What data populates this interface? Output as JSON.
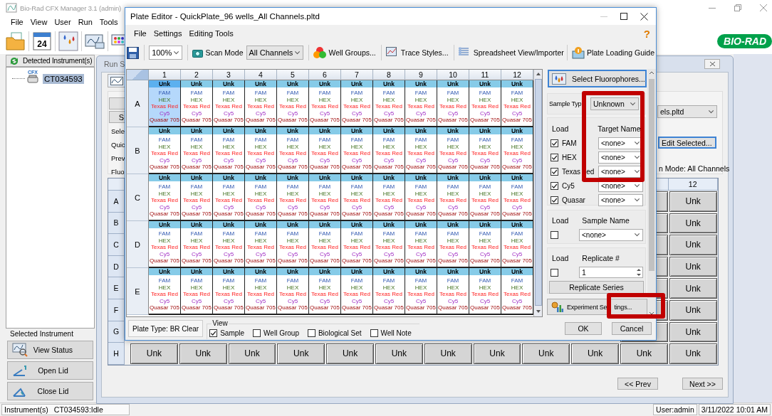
{
  "main_window": {
    "title": "Bio-Rad CFX Manager 3.1 (admin)",
    "menu": [
      "File",
      "View",
      "User",
      "Run",
      "Tools"
    ],
    "calendar_day": "24",
    "logo": "BIO-RAD"
  },
  "instrument_panel": {
    "header_button": "Detected Instrument(s)",
    "tree": [
      {
        "icon_label": "CFX",
        "label": "CT034593",
        "selected": true
      }
    ],
    "group_title": "Selected Instrument",
    "buttons": [
      "View Status",
      "Open Lid",
      "Close Lid"
    ]
  },
  "run_setup": {
    "title": "Run S",
    "side_button": "S",
    "labels": [
      "Sele",
      "Quic",
      "Prev",
      "Fluo"
    ],
    "file_dropdown": "els.pltd",
    "edit_button": "Edit Selected...",
    "scan_mode": "n Mode: All Channels",
    "column_header": "12",
    "row_labels": [
      "A",
      "B",
      "C",
      "D",
      "E",
      "F",
      "G",
      "H"
    ],
    "column_12_cells": [
      "Unk",
      "Unk",
      "Unk",
      "Unk",
      "Unk",
      "Unk",
      "Unk"
    ],
    "row_h_cells": [
      "Unk",
      "Unk",
      "Unk",
      "Unk",
      "Unk",
      "Unk",
      "Unk",
      "Unk",
      "Unk",
      "Unk",
      "Unk",
      "Unk"
    ],
    "buttons": [
      "<< Prev",
      "Next >>"
    ]
  },
  "plate_editor": {
    "title": "Plate Editor - QuickPlate_96 wells_All Channels.pltd",
    "menu": [
      "File",
      "Settings",
      "Editing Tools"
    ],
    "help": "?",
    "toolbar": {
      "zoom": "100%",
      "scan_mode_label": "Scan Mode",
      "scan_mode": "All Channels",
      "tools": [
        "Well Groups...",
        "Trace Styles...",
        "Spreadsheet View/Importer",
        "Plate Loading Guide"
      ]
    },
    "plate": {
      "columns": [
        "1",
        "2",
        "3",
        "4",
        "5",
        "6",
        "7",
        "8",
        "9",
        "10",
        "11",
        "12"
      ],
      "rows": [
        {
          "label": "A",
          "wells": [
            {
              "type": "Unk",
              "selected": true,
              "fluors": [
                "FAM",
                "HEX",
                "Texas Red",
                "Cy5",
                "Quasar 705"
              ]
            },
            {
              "type": "Unk",
              "selected": false,
              "fluors": [
                "FAM",
                "HEX",
                "Texas Red",
                "Cy5",
                "Quasar 705"
              ]
            },
            {
              "type": "Unk",
              "selected": false,
              "fluors": [
                "FAM",
                "HEX",
                "Texas Red",
                "Cy5",
                "Quasar 705"
              ]
            },
            {
              "type": "Unk",
              "selected": false,
              "fluors": [
                "FAM",
                "HEX",
                "Texas Red",
                "Cy5",
                "Quasar 705"
              ]
            },
            {
              "type": "Unk",
              "selected": false,
              "fluors": [
                "FAM",
                "HEX",
                "Texas Red",
                "Cy5",
                "Quasar 705"
              ]
            },
            {
              "type": "Unk",
              "selected": false,
              "fluors": [
                "FAM",
                "HEX",
                "Texas Red",
                "Cy5",
                "Quasar 705"
              ]
            },
            {
              "type": "Unk",
              "selected": false,
              "fluors": [
                "FAM",
                "HEX",
                "Texas Red",
                "Cy5",
                "Quasar 705"
              ]
            },
            {
              "type": "Unk",
              "selected": false,
              "fluors": [
                "FAM",
                "HEX",
                "Texas Red",
                "Cy5",
                "Quasar 705"
              ]
            },
            {
              "type": "Unk",
              "selected": false,
              "fluors": [
                "FAM",
                "HEX",
                "Texas Red",
                "Cy5",
                "Quasar 705"
              ]
            },
            {
              "type": "Unk",
              "selected": false,
              "fluors": [
                "FAM",
                "HEX",
                "Texas Red",
                "Cy5",
                "Quasar 705"
              ]
            },
            {
              "type": "Unk",
              "selected": false,
              "fluors": [
                "FAM",
                "HEX",
                "Texas Red",
                "Cy5",
                "Quasar 705"
              ]
            },
            {
              "type": "Unk",
              "selected": false,
              "fluors": [
                "FAM",
                "HEX",
                "Texas Red",
                "Cy5",
                "Quasar 705"
              ]
            }
          ]
        },
        {
          "label": "B",
          "wells": [
            {
              "type": "Unk",
              "selected": false,
              "fluors": [
                "FAM",
                "HEX",
                "Texas Red",
                "Cy5",
                "Quasar 705"
              ]
            },
            {
              "type": "Unk",
              "selected": false,
              "fluors": [
                "FAM",
                "HEX",
                "Texas Red",
                "Cy5",
                "Quasar 705"
              ]
            },
            {
              "type": "Unk",
              "selected": false,
              "fluors": [
                "FAM",
                "HEX",
                "Texas Red",
                "Cy5",
                "Quasar 705"
              ]
            },
            {
              "type": "Unk",
              "selected": false,
              "fluors": [
                "FAM",
                "HEX",
                "Texas Red",
                "Cy5",
                "Quasar 705"
              ]
            },
            {
              "type": "Unk",
              "selected": false,
              "fluors": [
                "FAM",
                "HEX",
                "Texas Red",
                "Cy5",
                "Quasar 705"
              ]
            },
            {
              "type": "Unk",
              "selected": false,
              "fluors": [
                "FAM",
                "HEX",
                "Texas Red",
                "Cy5",
                "Quasar 705"
              ]
            },
            {
              "type": "Unk",
              "selected": false,
              "fluors": [
                "FAM",
                "HEX",
                "Texas Red",
                "Cy5",
                "Quasar 705"
              ]
            },
            {
              "type": "Unk",
              "selected": false,
              "fluors": [
                "FAM",
                "HEX",
                "Texas Red",
                "Cy5",
                "Quasar 705"
              ]
            },
            {
              "type": "Unk",
              "selected": false,
              "fluors": [
                "FAM",
                "HEX",
                "Texas Red",
                "Cy5",
                "Quasar 705"
              ]
            },
            {
              "type": "Unk",
              "selected": false,
              "fluors": [
                "FAM",
                "HEX",
                "Texas Red",
                "Cy5",
                "Quasar 705"
              ]
            },
            {
              "type": "Unk",
              "selected": false,
              "fluors": [
                "FAM",
                "HEX",
                "Texas Red",
                "Cy5",
                "Quasar 705"
              ]
            },
            {
              "type": "Unk",
              "selected": false,
              "fluors": [
                "FAM",
                "HEX",
                "Texas Red",
                "Cy5",
                "Quasar 705"
              ]
            }
          ]
        },
        {
          "label": "C",
          "wells": [
            {
              "type": "Unk",
              "selected": false,
              "fluors": [
                "FAM",
                "HEX",
                "Texas Red",
                "Cy5",
                "Quasar 705"
              ]
            },
            {
              "type": "Unk",
              "selected": false,
              "fluors": [
                "FAM",
                "HEX",
                "Texas Red",
                "Cy5",
                "Quasar 705"
              ]
            },
            {
              "type": "Unk",
              "selected": false,
              "fluors": [
                "FAM",
                "HEX",
                "Texas Red",
                "Cy5",
                "Quasar 705"
              ]
            },
            {
              "type": "Unk",
              "selected": false,
              "fluors": [
                "FAM",
                "HEX",
                "Texas Red",
                "Cy5",
                "Quasar 705"
              ]
            },
            {
              "type": "Unk",
              "selected": false,
              "fluors": [
                "FAM",
                "HEX",
                "Texas Red",
                "Cy5",
                "Quasar 705"
              ]
            },
            {
              "type": "Unk",
              "selected": false,
              "fluors": [
                "FAM",
                "HEX",
                "Texas Red",
                "Cy5",
                "Quasar 705"
              ]
            },
            {
              "type": "Unk",
              "selected": false,
              "fluors": [
                "FAM",
                "HEX",
                "Texas Red",
                "Cy5",
                "Quasar 705"
              ]
            },
            {
              "type": "Unk",
              "selected": false,
              "fluors": [
                "FAM",
                "HEX",
                "Texas Red",
                "Cy5",
                "Quasar 705"
              ]
            },
            {
              "type": "Unk",
              "selected": false,
              "fluors": [
                "FAM",
                "HEX",
                "Texas Red",
                "Cy5",
                "Quasar 705"
              ]
            },
            {
              "type": "Unk",
              "selected": false,
              "fluors": [
                "FAM",
                "HEX",
                "Texas Red",
                "Cy5",
                "Quasar 705"
              ]
            },
            {
              "type": "Unk",
              "selected": false,
              "fluors": [
                "FAM",
                "HEX",
                "Texas Red",
                "Cy5",
                "Quasar 705"
              ]
            },
            {
              "type": "Unk",
              "selected": false,
              "fluors": [
                "FAM",
                "HEX",
                "Texas Red",
                "Cy5",
                "Quasar 705"
              ]
            }
          ]
        },
        {
          "label": "D",
          "wells": [
            {
              "type": "Unk",
              "selected": false,
              "fluors": [
                "FAM",
                "HEX",
                "Texas Red",
                "Cy5",
                "Quasar 705"
              ]
            },
            {
              "type": "Unk",
              "selected": false,
              "fluors": [
                "FAM",
                "HEX",
                "Texas Red",
                "Cy5",
                "Quasar 705"
              ]
            },
            {
              "type": "Unk",
              "selected": false,
              "fluors": [
                "FAM",
                "HEX",
                "Texas Red",
                "Cy5",
                "Quasar 705"
              ]
            },
            {
              "type": "Unk",
              "selected": false,
              "fluors": [
                "FAM",
                "HEX",
                "Texas Red",
                "Cy5",
                "Quasar 705"
              ]
            },
            {
              "type": "Unk",
              "selected": false,
              "fluors": [
                "FAM",
                "HEX",
                "Texas Red",
                "Cy5",
                "Quasar 705"
              ]
            },
            {
              "type": "Unk",
              "selected": false,
              "fluors": [
                "FAM",
                "HEX",
                "Texas Red",
                "Cy5",
                "Quasar 705"
              ]
            },
            {
              "type": "Unk",
              "selected": false,
              "fluors": [
                "FAM",
                "HEX",
                "Texas Red",
                "Cy5",
                "Quasar 705"
              ]
            },
            {
              "type": "Unk",
              "selected": false,
              "fluors": [
                "FAM",
                "HEX",
                "Texas Red",
                "Cy5",
                "Quasar 705"
              ]
            },
            {
              "type": "Unk",
              "selected": false,
              "fluors": [
                "FAM",
                "HEX",
                "Texas Red",
                "Cy5",
                "Quasar 705"
              ]
            },
            {
              "type": "Unk",
              "selected": false,
              "fluors": [
                "FAM",
                "HEX",
                "Texas Red",
                "Cy5",
                "Quasar 705"
              ]
            },
            {
              "type": "Unk",
              "selected": false,
              "fluors": [
                "FAM",
                "HEX",
                "Texas Red",
                "Cy5",
                "Quasar 705"
              ]
            },
            {
              "type": "Unk",
              "selected": false,
              "fluors": [
                "FAM",
                "HEX",
                "Texas Red",
                "Cy5",
                "Quasar 705"
              ]
            }
          ]
        },
        {
          "label": "E",
          "wells": [
            {
              "type": "Unk",
              "selected": false,
              "fluors": [
                "FAM",
                "HEX",
                "Texas Red",
                "Cy5",
                "Quasar 705"
              ]
            },
            {
              "type": "Unk",
              "selected": false,
              "fluors": [
                "FAM",
                "HEX",
                "Texas Red",
                "Cy5",
                "Quasar 705"
              ]
            },
            {
              "type": "Unk",
              "selected": false,
              "fluors": [
                "FAM",
                "HEX",
                "Texas Red",
                "Cy5",
                "Quasar 705"
              ]
            },
            {
              "type": "Unk",
              "selected": false,
              "fluors": [
                "FAM",
                "HEX",
                "Texas Red",
                "Cy5",
                "Quasar 705"
              ]
            },
            {
              "type": "Unk",
              "selected": false,
              "fluors": [
                "FAM",
                "HEX",
                "Texas Red",
                "Cy5",
                "Quasar 705"
              ]
            },
            {
              "type": "Unk",
              "selected": false,
              "fluors": [
                "FAM",
                "HEX",
                "Texas Red",
                "Cy5",
                "Quasar 705"
              ]
            },
            {
              "type": "Unk",
              "selected": false,
              "fluors": [
                "FAM",
                "HEX",
                "Texas Red",
                "Cy5",
                "Quasar 705"
              ]
            },
            {
              "type": "Unk",
              "selected": false,
              "fluors": [
                "FAM",
                "HEX",
                "Texas Red",
                "Cy5",
                "Quasar 705"
              ]
            },
            {
              "type": "Unk",
              "selected": false,
              "fluors": [
                "FAM",
                "HEX",
                "Texas Red",
                "Cy5",
                "Quasar 705"
              ]
            },
            {
              "type": "Unk",
              "selected": false,
              "fluors": [
                "FAM",
                "HEX",
                "Texas Red",
                "Cy5",
                "Quasar 705"
              ]
            },
            {
              "type": "Unk",
              "selected": false,
              "fluors": [
                "FAM",
                "HEX",
                "Texas Red",
                "Cy5",
                "Quasar 705"
              ]
            },
            {
              "type": "Unk",
              "selected": false,
              "fluors": [
                "FAM",
                "HEX",
                "Texas Red",
                "Cy5",
                "Quasar 705"
              ]
            }
          ]
        }
      ]
    },
    "side_panel": {
      "select_button": "Select Fluorophores...",
      "sample_type_label": "Sample Typ",
      "sample_type": "Unknown",
      "load_label": "Load",
      "target_label": "Target Name",
      "targets": [
        {
          "fluor": "FAM",
          "checked": true,
          "target": "<none>"
        },
        {
          "fluor": "HEX",
          "checked": true,
          "target": "<none>"
        },
        {
          "fluor": "Texas",
          "fluor_rest": "ed",
          "checked": true,
          "target": "<none>"
        },
        {
          "fluor": "Cy5",
          "checked": true,
          "target": "<none>"
        },
        {
          "fluor": "Quasar",
          "checked": true,
          "target": "<none>"
        }
      ],
      "sample": {
        "load_label": "Load",
        "name_label": "Sample Name",
        "checked": false,
        "value": "<none>"
      },
      "replicate": {
        "load_label": "Load",
        "number_label": "Replicate #",
        "checked": false,
        "value": "1",
        "series_button": "Replicate Series"
      },
      "settings_button": "Experiment Se",
      "settings_button_rest": "tings..."
    },
    "bottom_bar": {
      "plate_type": "Plate Type: BR Clear",
      "view_label": "View",
      "view_options": [
        {
          "label": "Sample",
          "checked": true
        },
        {
          "label": "Well Group",
          "checked": false
        },
        {
          "label": "Biological Set",
          "checked": false
        },
        {
          "label": "Well Note",
          "checked": false
        }
      ],
      "buttons": [
        "OK",
        "Cancel"
      ]
    }
  },
  "status_bar": {
    "instrument_label": "Instrument(s)",
    "instrument_status": "CT034593:Idle",
    "user": "User:admin",
    "datetime": "3/11/2022 10:01 AM"
  }
}
